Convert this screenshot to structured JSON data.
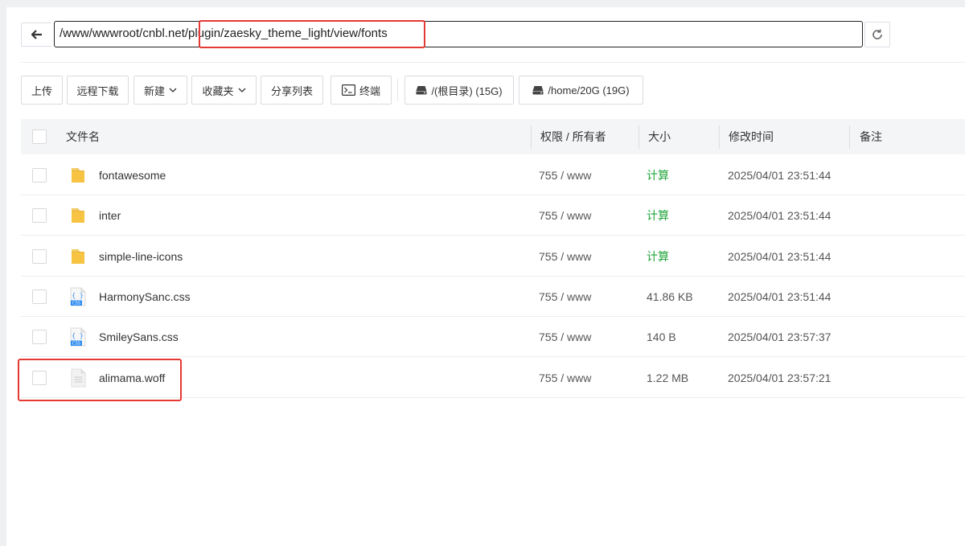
{
  "path": {
    "value": "/www/wwwroot/cnbl.net/plugin/zaesky_theme_light/view/fonts"
  },
  "toolbar": {
    "upload": "上传",
    "remote_download": "远程下载",
    "new": "新建",
    "favorites": "收藏夹",
    "share_list": "分享列表",
    "terminal": "终端",
    "disk_root": "/(根目录) (15G)",
    "disk_home": "/home/20G (19G)"
  },
  "columns": {
    "name": "文件名",
    "perm": "权限 / 所有者",
    "size": "大小",
    "mtime": "修改时间",
    "remark": "备注"
  },
  "files": [
    {
      "name": "fontawesome",
      "type": "folder",
      "perm": "755 / www",
      "size": "计算",
      "mtime": "2025/04/01 23:51:44"
    },
    {
      "name": "inter",
      "type": "folder",
      "perm": "755 / www",
      "size": "计算",
      "mtime": "2025/04/01 23:51:44"
    },
    {
      "name": "simple-line-icons",
      "type": "folder",
      "perm": "755 / www",
      "size": "计算",
      "mtime": "2025/04/01 23:51:44"
    },
    {
      "name": "HarmonySanc.css",
      "type": "css",
      "perm": "755 / www",
      "size": "41.86 KB",
      "mtime": "2025/04/01 23:51:44"
    },
    {
      "name": "SmileySans.css",
      "type": "css",
      "perm": "755 / www",
      "size": "140 B",
      "mtime": "2025/04/01 23:57:37"
    },
    {
      "name": "alimama.woff",
      "type": "file",
      "perm": "755 / www",
      "size": "1.22 MB",
      "mtime": "2025/04/01 23:57:21"
    }
  ],
  "icons": {
    "back": "arrow-left-icon",
    "refresh": "refresh-icon",
    "chevron": "chevron-down-icon",
    "terminal": "terminal-icon",
    "disk": "disk-icon",
    "folder": "folder-icon",
    "css": "css-file-icon",
    "file": "file-icon"
  },
  "colors": {
    "highlight": "#e53935",
    "calc_link": "#20a53a",
    "folder": "#f6c342",
    "css_badge": "#2d8cf0"
  }
}
